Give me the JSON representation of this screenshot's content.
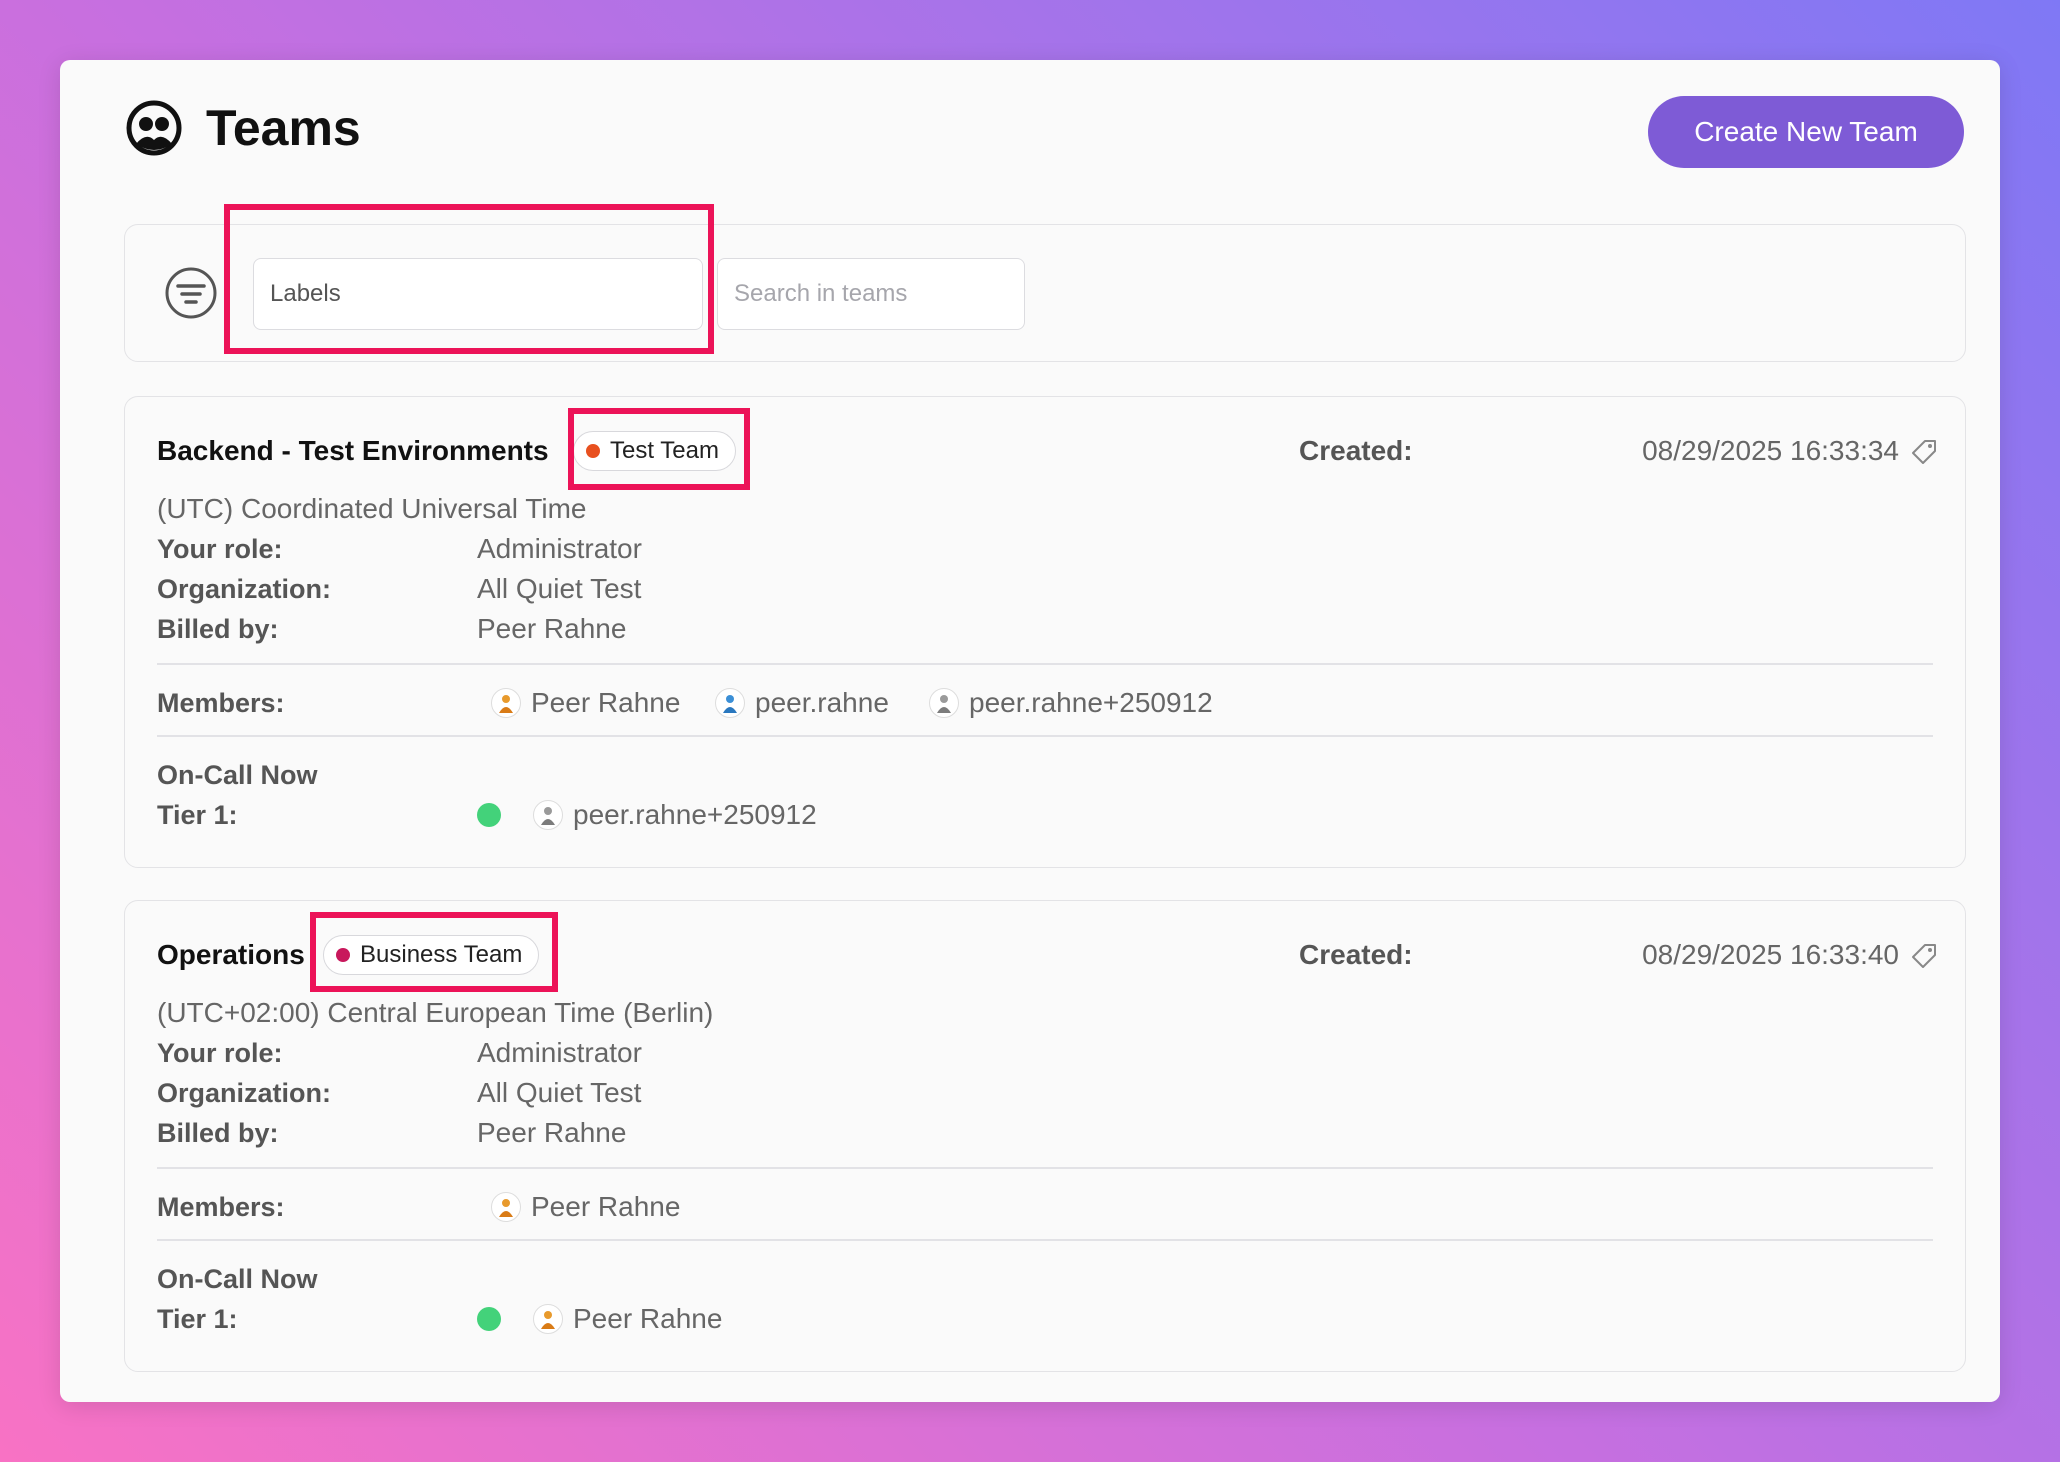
{
  "header": {
    "title": "Teams",
    "create_button": "Create New Team"
  },
  "filters": {
    "labels_placeholder": "Labels",
    "search_placeholder": "Search in teams"
  },
  "labels": {
    "created": "Created:",
    "your_role": "Your role:",
    "organization": "Organization:",
    "billed_by": "Billed by:",
    "members": "Members:",
    "on_call_now": "On-Call Now",
    "tier1": "Tier 1:"
  },
  "teams": [
    {
      "name": "Backend - Test Environments",
      "badge": {
        "label": "Test Team",
        "color": "#e8501f"
      },
      "created": "08/29/2025 16:33:34",
      "timezone": "(UTC) Coordinated Universal Time",
      "role": "Administrator",
      "organization": "All Quiet Test",
      "billed_by": "Peer Rahne",
      "members": [
        {
          "name": "Peer Rahne",
          "icon": "person-orange-icon"
        },
        {
          "name": "peer.rahne",
          "icon": "person-blue-icon"
        },
        {
          "name": "peer.rahne+250912",
          "icon": "person-gray-icon"
        }
      ],
      "on_call_tier1": {
        "name": "peer.rahne+250912",
        "icon": "person-gray-icon",
        "status_color": "#43d27a"
      }
    },
    {
      "name": "Operations",
      "badge": {
        "label": "Business Team",
        "color": "#c8185c"
      },
      "created": "08/29/2025 16:33:40",
      "timezone": "(UTC+02:00) Central European Time (Berlin)",
      "role": "Administrator",
      "organization": "All Quiet Test",
      "billed_by": "Peer Rahne",
      "members": [
        {
          "name": "Peer Rahne",
          "icon": "person-orange-icon"
        }
      ],
      "on_call_tier1": {
        "name": "Peer Rahne",
        "icon": "person-orange-icon",
        "status_color": "#43d27a"
      }
    }
  ]
}
